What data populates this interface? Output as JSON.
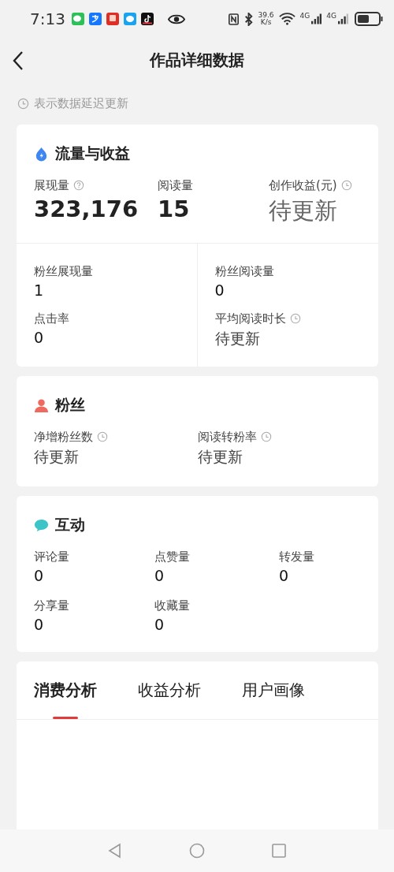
{
  "status_bar": {
    "time": "7:13",
    "speed_value": "39.6",
    "speed_unit": "K/s",
    "network_1": "4G",
    "network_2": "4G"
  },
  "header": {
    "title": "作品详细数据"
  },
  "note": "表示数据延迟更新",
  "traffic": {
    "title": "流量与收益",
    "top_metrics": [
      {
        "kind": "help",
        "label": "展现量",
        "value": "323,176",
        "pending": false
      },
      {
        "kind": "plain",
        "label": "阅读量",
        "value": "15",
        "pending": false
      },
      {
        "kind": "clock",
        "label": "创作收益(元)",
        "value": "待更新",
        "pending": true
      }
    ],
    "fan_metrics": [
      {
        "kind": "plain",
        "label": "粉丝展现量",
        "value": "1",
        "pending": false
      },
      {
        "kind": "plain",
        "label": "粉丝阅读量",
        "value": "0",
        "pending": false
      },
      {
        "kind": "plain",
        "label": "点击率",
        "value": "0",
        "pending": false
      },
      {
        "kind": "clock",
        "label": "平均阅读时长",
        "value": "待更新",
        "pending": true
      }
    ]
  },
  "fans": {
    "title": "粉丝",
    "metrics": [
      {
        "kind": "clock",
        "label": "净增粉丝数",
        "value": "待更新",
        "pending": true
      },
      {
        "kind": "clock",
        "label": "阅读转粉率",
        "value": "待更新",
        "pending": true
      }
    ]
  },
  "interaction": {
    "title": "互动",
    "metrics": [
      {
        "label": "评论量",
        "value": "0",
        "pending": false
      },
      {
        "label": "点赞量",
        "value": "0",
        "pending": false
      },
      {
        "label": "转发量",
        "value": "0",
        "pending": false
      },
      {
        "label": "分享量",
        "value": "0",
        "pending": false
      },
      {
        "label": "收藏量",
        "value": "0",
        "pending": false
      }
    ]
  },
  "tabs": [
    {
      "label": "消费分析",
      "selected": true
    },
    {
      "label": "收益分析",
      "selected": false
    },
    {
      "label": "用户画像",
      "selected": false
    }
  ]
}
